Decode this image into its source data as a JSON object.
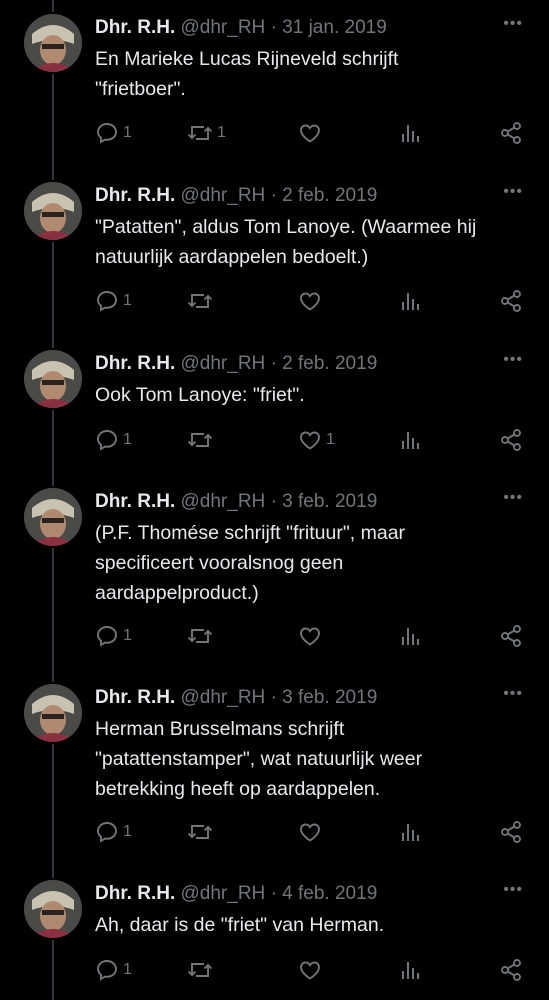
{
  "colors": {
    "background": "#000000",
    "text": "#e7e9ea",
    "muted": "#71767b",
    "line": "#333639"
  },
  "icons": {
    "more": "more-icon",
    "reply": "reply-icon",
    "retweet": "retweet-icon",
    "like": "like-icon",
    "views": "views-icon",
    "share": "share-icon"
  },
  "tweets": [
    {
      "name": "Dhr. R.H.",
      "handle": "@dhr_RH",
      "sep": "·",
      "date": "31 jan. 2019",
      "text": "En Marieke Lucas Rijneveld schrijft\n\"frietboer\".",
      "replies": "1",
      "retweets": "1",
      "likes": ""
    },
    {
      "name": "Dhr. R.H.",
      "handle": "@dhr_RH",
      "sep": "·",
      "date": "2 feb. 2019",
      "text": "\"Patatten\", aldus Tom Lanoye. (Waarmee hij\nnatuurlijk aardappelen bedoelt.)",
      "replies": "1",
      "retweets": "",
      "likes": ""
    },
    {
      "name": "Dhr. R.H.",
      "handle": "@dhr_RH",
      "sep": "·",
      "date": "2 feb. 2019",
      "text": "Ook Tom Lanoye: \"friet\".",
      "replies": "1",
      "retweets": "",
      "likes": "1"
    },
    {
      "name": "Dhr. R.H.",
      "handle": "@dhr_RH",
      "sep": "·",
      "date": "3 feb. 2019",
      "text": "(P.F. Thomése schrijft \"frituur\", maar\nspecificeert vooralsnog geen\naardappelproduct.)",
      "replies": "1",
      "retweets": "",
      "likes": ""
    },
    {
      "name": "Dhr. R.H.",
      "handle": "@dhr_RH",
      "sep": "·",
      "date": "3 feb. 2019",
      "text": "Herman Brusselmans schrijft\n\"patattenstamper\", wat natuurlijk weer\nbetrekking heeft op aardappelen.",
      "replies": "1",
      "retweets": "",
      "likes": ""
    },
    {
      "name": "Dhr. R.H.",
      "handle": "@dhr_RH",
      "sep": "·",
      "date": "4 feb. 2019",
      "text": "Ah, daar is de \"friet\" van Herman.",
      "replies": "1",
      "retweets": "",
      "likes": ""
    }
  ]
}
